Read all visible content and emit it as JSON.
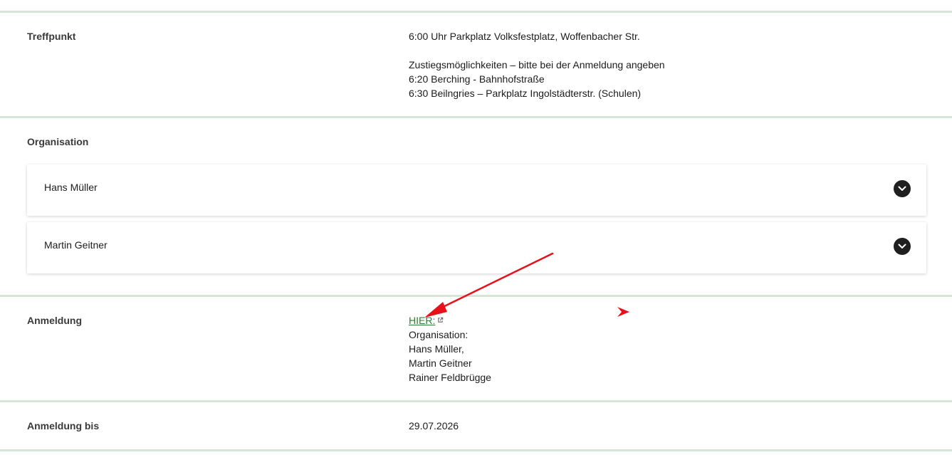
{
  "treffpunkt": {
    "label": "Treffpunkt",
    "line1": "6:00 Uhr Parkplatz Volksfestplatz, Woffenbacher Str.",
    "line2": "Zustiegsmöglichkeiten – bitte bei der Anmeldung angeben",
    "line3": "6:20 Berching - Bahnhofstraße",
    "line4": "6:30 Beilngries – Parkplatz Ingolstädterstr. (Schulen)"
  },
  "organisation": {
    "label": "Organisation",
    "contacts": [
      {
        "name": "Hans Müller",
        "icon": "chevron-down-icon"
      },
      {
        "name": "Martin Geitner",
        "icon": "chevron-down-icon"
      }
    ]
  },
  "anmeldung": {
    "label": "Anmeldung",
    "link_text": "HIER:",
    "link_icon": "external-link-icon",
    "lines": [
      "Organisation:",
      "Hans Müller,",
      "Martin Geitner",
      "Rainer Feldbrügge"
    ]
  },
  "anmeldung_bis": {
    "label": "Anmeldung bis",
    "value": "29.07.2026"
  },
  "colors": {
    "divider": "#d6e6d6",
    "link": "#2e7d32",
    "annotation_arrow": "#e8101a"
  }
}
